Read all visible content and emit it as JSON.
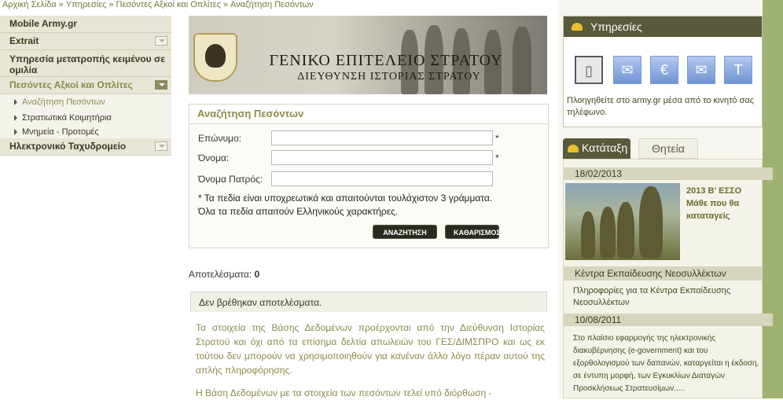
{
  "breadcrumb": [
    "Αρχική Σελίδα",
    "Υπηρεσίες",
    "Πεσόντες Αξκοί και Οπλίτες",
    "Αναζήτηση Πεσόντων"
  ],
  "breadcrumb_sep": "»",
  "sidebar": {
    "items": [
      {
        "label": "Mobile Army.gr"
      },
      {
        "label": "Extrait"
      },
      {
        "label": "Υπηρεσία μετατροπής κειμένου σε ομιλία"
      },
      {
        "label": "Πεσόντες Αξκοί και Οπλίτες"
      },
      {
        "label": "Ηλεκτρονικό Ταχυδρομείο"
      }
    ],
    "subitems": [
      "Αναζήτηση Πεσόντων",
      "Στρατιωτικά Κοιμητήρια",
      "Μνημεία - Προτομές"
    ]
  },
  "banner": {
    "title": "ΓΕΝΙΚΟ ΕΠΙΤΕΛΕΙΟ ΣΤΡΑΤΟΥ",
    "subtitle": "ΔΙΕΥΘΥΝΣΗ ΙΣΤΟΡΙΑΣ ΣΤΡΑΤΟΥ"
  },
  "search": {
    "title": "Αναζήτηση Πεσόντων",
    "fields": [
      {
        "label": "Επώνυμο:",
        "value": "",
        "required": "*"
      },
      {
        "label": "Όνομα:",
        "value": "",
        "required": "*"
      },
      {
        "label": "Όνομα Πατρός:",
        "value": "",
        "required": ""
      }
    ],
    "note1": "* Τα πεδία είναι υποχρεωτικά και απαιτούνται τουλάχιστον 3 γράμματα.",
    "note2": "Όλα τα πεδία απαιτούν Ελληνικούς χαρακτήρες.",
    "search_button": "ΑΝΑΖΗΤΗΣΗ",
    "clear_button": "ΚΑΘΑΡΙΣΜΟΣ"
  },
  "results": {
    "label": "Αποτελέσματα:",
    "count": "0",
    "empty_message": "Δεν βρέθηκαν αποτελέσματα.",
    "disclaimer": "Τα στοιχεία της Βάσης Δεδομένων προέρχονται από την Διεύθυνση Ιστορίας Στρατού και όχι από τα επίσημα δελτία απωλειών του ΓΕΣ/ΔΙΜΣΠΡΟ και ως εκ τούτου δεν μπορούν να χρησιμοποιηθούν για κανέναν άλλο λόγο πέραν αυτού της απλής πληροφόρησης.",
    "disclaimer2": "Η Βάση Δεδομένων με τα στοιχεία των πεσόντων τελεί υπό διόρθωση -"
  },
  "services": {
    "title": "Υπηρεσίες",
    "icons": [
      "mobile-icon",
      "map-icon",
      "euro-icon",
      "mail-icon",
      "text-to-speech-icon"
    ],
    "icon_glyphs": [
      "▯",
      "✉",
      "€",
      "✉",
      "T"
    ],
    "description": "Πλοηγηθείτε στο army.gr μέσα από το κινητό σας τηλέφωνο."
  },
  "tabs": {
    "active": "Κατάταξη",
    "inactive": "Θητεία"
  },
  "news": {
    "date1": "18/02/2013",
    "item1_title": "2013 Β' ΕΣΣΟ Μάθε που θα καταταγείς",
    "section": "Κέντρα Εκπαίδευσης Νεοσυλλέκτων",
    "section_text": "Πληροφορίες για τα Κέντρα Εκπαίδευσης Νεοσυλλέκτων",
    "date2": "10/08/2011",
    "item2_text": "Στο πλαίσιο εφαρμογής της ηλεκτρονικής διακυβέρνησης (e-government) και του εξορθολογισμού των δαπανών, καταργείται η έκδοση, σε έντυπη μορφή, των Εγκυκλίων Διαταγών Προσκλήσεως Στρατευσίμων....."
  },
  "colors": {
    "accent_olive": "#8c8a4a",
    "header_dark": "#595a3c",
    "edge_green": "#9fb272"
  }
}
